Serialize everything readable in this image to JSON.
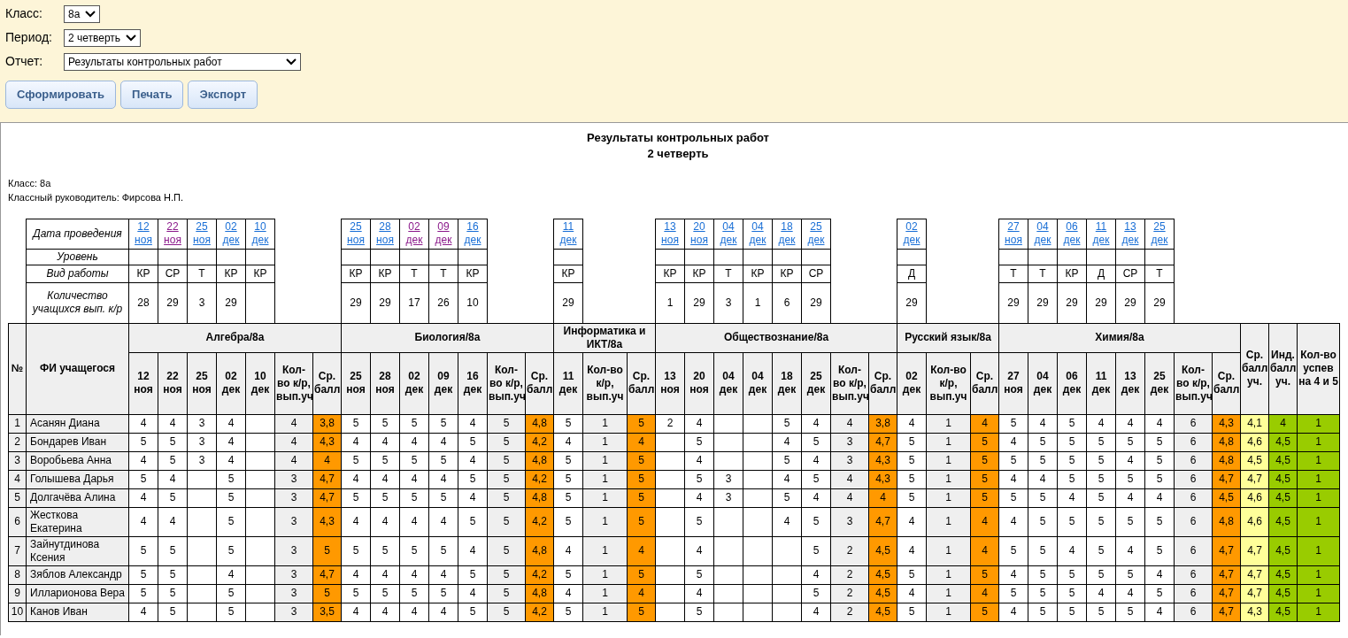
{
  "filters": [
    {
      "label": "Класс:",
      "value": "8а"
    },
    {
      "label": "Период:",
      "value": "2 четверть"
    },
    {
      "label": "Отчет:",
      "value": "Результаты контрольных работ"
    }
  ],
  "buttons": [
    "Сформировать",
    "Печать",
    "Экспорт"
  ],
  "report": {
    "title": "Результаты контрольных работ",
    "subtitle": "2 четверть",
    "info": [
      "Класс: 8а",
      "Классный руководитель: Фирсова Н.П."
    ],
    "work_labels": [
      "Дата проведения",
      "Уровень",
      "Вид работы",
      "Количество учащихся вып. к/р"
    ],
    "number_header": "№",
    "name_header": "ФИ учащегося",
    "final_headers": [
      "Ср. балл уч.",
      "Инд. балл уч.",
      "Кол-во успев на 4 и 5"
    ],
    "subjects": [
      {
        "name": "Алгебра/8а",
        "count_label": "Кол-во к/р, вып.уч",
        "avg_label": "Ср. балл",
        "works": [
          {
            "date": "12 ноя",
            "visited": false,
            "kind": "КР",
            "students": "28",
            "column": "12 ноя"
          },
          {
            "date": "22 ноя",
            "visited": true,
            "kind": "СР",
            "students": "29",
            "column": "22 ноя"
          },
          {
            "date": "25 ноя",
            "visited": false,
            "kind": "Т",
            "students": "3",
            "column": "25 ноя"
          },
          {
            "date": "02 дек",
            "visited": false,
            "kind": "КР",
            "students": "29",
            "column": "02 дек"
          },
          {
            "date": "10 дек",
            "visited": false,
            "kind": "КР",
            "column": "10 дек"
          }
        ]
      },
      {
        "name": "Биология/8а",
        "count_label": "Кол-во к/р, вып.уч",
        "avg_label": "Ср. балл",
        "works": [
          {
            "date": "25 ноя",
            "visited": false,
            "kind": "КР",
            "students": "29",
            "column": "25 ноя"
          },
          {
            "date": "28 ноя",
            "visited": false,
            "kind": "КР",
            "students": "29",
            "column": "28 ноя"
          },
          {
            "date": "02 дек",
            "visited": true,
            "kind": "Т",
            "students": "17",
            "column": "02 дек"
          },
          {
            "date": "09 дек",
            "visited": true,
            "kind": "Т",
            "students": "26",
            "column": "09 дек"
          },
          {
            "date": "16 дек",
            "visited": false,
            "kind": "КР",
            "students": "10",
            "column": "16 дек"
          }
        ]
      },
      {
        "name": "Информатика и ИКТ/8а",
        "count_label": "Кол-во к/р, вып.уч",
        "avg_label": "Ср. балл",
        "works": [
          {
            "date": "11 дек",
            "visited": false,
            "kind": "КР",
            "students": "29",
            "column": "11 дек"
          }
        ]
      },
      {
        "name": "Обществознание/8а",
        "count_label": "Кол-во к/р, вып.уч",
        "avg_label": "Ср. балл",
        "works": [
          {
            "date": "13 ноя",
            "visited": false,
            "kind": "КР",
            "students": "1",
            "column": "13 ноя"
          },
          {
            "date": "20 ноя",
            "visited": false,
            "kind": "КР",
            "students": "29",
            "column": "20 ноя"
          },
          {
            "date": "04 дек",
            "visited": false,
            "kind": "Т",
            "students": "3",
            "column": "04 дек"
          },
          {
            "date": "04 дек",
            "visited": false,
            "kind": "КР",
            "students": "1",
            "column": "04 дек"
          },
          {
            "date": "18 дек",
            "visited": false,
            "kind": "КР",
            "students": "6",
            "column": "18 дек"
          },
          {
            "date": "25 дек",
            "visited": false,
            "kind": "СР",
            "students": "29",
            "column": "25 дек"
          }
        ]
      },
      {
        "name": "Русский язык/8а",
        "count_label": "Кол-во к/р, вып.уч",
        "avg_label": "Ср. балл",
        "works": [
          {
            "date": "02 дек",
            "visited": false,
            "kind": "Д",
            "students": "29",
            "column": "02 дек"
          }
        ]
      },
      {
        "name": "Химия/8а",
        "count_label": "Кол-во к/р, вып.уч",
        "avg_label": "Ср. балл",
        "works": [
          {
            "date": "27 ноя",
            "visited": false,
            "kind": "Т",
            "students": "29",
            "column": "27 ноя"
          },
          {
            "date": "04 дек",
            "visited": false,
            "kind": "Т",
            "students": "29",
            "column": "04 дек"
          },
          {
            "date": "06 дек",
            "visited": false,
            "kind": "КР",
            "students": "29",
            "column": "06 дек"
          },
          {
            "date": "11 дек",
            "visited": false,
            "kind": "Д",
            "students": "29",
            "column": "11 дек"
          },
          {
            "date": "13 дек",
            "visited": false,
            "kind": "СР",
            "students": "29",
            "column": "13 дек"
          },
          {
            "date": "25 дек",
            "visited": false,
            "kind": "Т",
            "students": "29",
            "column": "25 дек"
          }
        ]
      }
    ],
    "rows": [
      {
        "num": "1",
        "name": "Асанян Диана",
        "subjects": [
          {
            "marks": [
              {
                "mark": "4"
              },
              {
                "mark": "4"
              },
              {
                "mark": "3"
              },
              {
                "mark": "4"
              },
              {
                "blank": true
              }
            ],
            "count": "4",
            "avg": "3,8"
          },
          {
            "marks": [
              {
                "mark": "5"
              },
              {
                "mark": "5"
              },
              {
                "mark": "5"
              },
              {
                "mark": "5"
              },
              {
                "mark": "4"
              }
            ],
            "count": "5",
            "avg": "4,8"
          },
          {
            "marks": [
              {
                "mark": "5"
              }
            ],
            "count": "1",
            "avg": "5"
          },
          {
            "marks": [
              {
                "mark": "2"
              },
              {
                "mark": "4"
              },
              {
                "blank": true
              },
              {
                "blank": true
              },
              {
                "mark": "5"
              },
              {
                "mark": "4"
              }
            ],
            "count": "4",
            "avg": "3,8"
          },
          {
            "marks": [
              {
                "mark": "4"
              }
            ],
            "count": "1",
            "avg": "4"
          },
          {
            "marks": [
              {
                "mark": "5"
              },
              {
                "mark": "4"
              },
              {
                "mark": "5"
              },
              {
                "mark": "4"
              },
              {
                "mark": "4"
              },
              {
                "mark": "4"
              }
            ],
            "count": "6",
            "avg": "4,3"
          }
        ],
        "total_avg": "4,1",
        "ind_avg": "4",
        "success": "1"
      },
      {
        "num": "2",
        "name": "Бондарев Иван",
        "subjects": [
          {
            "marks": [
              {
                "mark": "5"
              },
              {
                "mark": "5"
              },
              {
                "mark": "3"
              },
              {
                "mark": "4"
              },
              {
                "blank": true
              }
            ],
            "count": "4",
            "avg": "4,3"
          },
          {
            "marks": [
              {
                "mark": "4"
              },
              {
                "mark": "4"
              },
              {
                "mark": "4"
              },
              {
                "mark": "4"
              },
              {
                "mark": "5"
              }
            ],
            "count": "5",
            "avg": "4,2"
          },
          {
            "marks": [
              {
                "mark": "4"
              }
            ],
            "count": "1",
            "avg": "4"
          },
          {
            "marks": [
              {
                "blank": true
              },
              {
                "mark": "5"
              },
              {
                "blank": true
              },
              {
                "blank": true
              },
              {
                "mark": "4"
              },
              {
                "mark": "5"
              }
            ],
            "count": "3",
            "avg": "4,7"
          },
          {
            "marks": [
              {
                "mark": "5"
              }
            ],
            "count": "1",
            "avg": "5"
          },
          {
            "marks": [
              {
                "mark": "4"
              },
              {
                "mark": "5"
              },
              {
                "mark": "5"
              },
              {
                "mark": "5"
              },
              {
                "mark": "5"
              },
              {
                "mark": "5"
              }
            ],
            "count": "6",
            "avg": "4,8"
          }
        ],
        "total_avg": "4,6",
        "ind_avg": "4,5",
        "success": "1"
      },
      {
        "num": "3",
        "name": "Воробьева Анна",
        "subjects": [
          {
            "marks": [
              {
                "mark": "4"
              },
              {
                "mark": "5"
              },
              {
                "mark": "3"
              },
              {
                "mark": "4"
              },
              {
                "blank": true
              }
            ],
            "count": "4",
            "avg": "4"
          },
          {
            "marks": [
              {
                "mark": "5"
              },
              {
                "mark": "5"
              },
              {
                "mark": "5"
              },
              {
                "mark": "5"
              },
              {
                "mark": "4"
              }
            ],
            "count": "5",
            "avg": "4,8"
          },
          {
            "marks": [
              {
                "mark": "5"
              }
            ],
            "count": "1",
            "avg": "5"
          },
          {
            "marks": [
              {
                "blank": true
              },
              {
                "mark": "4"
              },
              {
                "blank": true
              },
              {
                "blank": true
              },
              {
                "mark": "5"
              },
              {
                "mark": "4"
              }
            ],
            "count": "3",
            "avg": "4,3"
          },
          {
            "marks": [
              {
                "mark": "5"
              }
            ],
            "count": "1",
            "avg": "5"
          },
          {
            "marks": [
              {
                "mark": "5"
              },
              {
                "mark": "5"
              },
              {
                "mark": "5"
              },
              {
                "mark": "5"
              },
              {
                "mark": "4"
              },
              {
                "mark": "5"
              }
            ],
            "count": "6",
            "avg": "4,8"
          }
        ],
        "total_avg": "4,5",
        "ind_avg": "4,5",
        "success": "1"
      },
      {
        "num": "4",
        "name": "Голышева Дарья",
        "subjects": [
          {
            "marks": [
              {
                "mark": "5"
              },
              {
                "mark": "4"
              },
              {
                "blank": true
              },
              {
                "mark": "5"
              },
              {
                "blank": true
              }
            ],
            "count": "3",
            "avg": "4,7"
          },
          {
            "marks": [
              {
                "mark": "4"
              },
              {
                "mark": "4"
              },
              {
                "mark": "4"
              },
              {
                "mark": "4"
              },
              {
                "mark": "5"
              }
            ],
            "count": "5",
            "avg": "4,2"
          },
          {
            "marks": [
              {
                "mark": "5"
              }
            ],
            "count": "1",
            "avg": "5"
          },
          {
            "marks": [
              {
                "blank": true
              },
              {
                "mark": "5"
              },
              {
                "mark": "3"
              },
              {
                "blank": true
              },
              {
                "mark": "4"
              },
              {
                "mark": "5"
              }
            ],
            "count": "4",
            "avg": "4,3"
          },
          {
            "marks": [
              {
                "mark": "5"
              }
            ],
            "count": "1",
            "avg": "5"
          },
          {
            "marks": [
              {
                "mark": "4"
              },
              {
                "mark": "4"
              },
              {
                "mark": "5"
              },
              {
                "mark": "5"
              },
              {
                "mark": "5"
              },
              {
                "mark": "5"
              }
            ],
            "count": "6",
            "avg": "4,7"
          }
        ],
        "total_avg": "4,7",
        "ind_avg": "4,5",
        "success": "1"
      },
      {
        "num": "5",
        "name": "Долгачёва Алина",
        "subjects": [
          {
            "marks": [
              {
                "mark": "4"
              },
              {
                "mark": "5"
              },
              {
                "blank": true
              },
              {
                "mark": "5"
              },
              {
                "blank": true
              }
            ],
            "count": "3",
            "avg": "4,7"
          },
          {
            "marks": [
              {
                "mark": "5"
              },
              {
                "mark": "5"
              },
              {
                "mark": "5"
              },
              {
                "mark": "5"
              },
              {
                "mark": "4"
              }
            ],
            "count": "5",
            "avg": "4,8"
          },
          {
            "marks": [
              {
                "mark": "5"
              }
            ],
            "count": "1",
            "avg": "5"
          },
          {
            "marks": [
              {
                "blank": true
              },
              {
                "mark": "4"
              },
              {
                "mark": "3"
              },
              {
                "blank": true
              },
              {
                "mark": "5"
              },
              {
                "mark": "4"
              }
            ],
            "count": "4",
            "avg": "4"
          },
          {
            "marks": [
              {
                "mark": "5"
              }
            ],
            "count": "1",
            "avg": "5"
          },
          {
            "marks": [
              {
                "mark": "5"
              },
              {
                "mark": "5"
              },
              {
                "mark": "4"
              },
              {
                "mark": "5"
              },
              {
                "mark": "4"
              },
              {
                "mark": "4"
              }
            ],
            "count": "6",
            "avg": "4,5"
          }
        ],
        "total_avg": "4,6",
        "ind_avg": "4,5",
        "success": "1"
      },
      {
        "num": "6",
        "name": "Жесткова Екатерина",
        "subjects": [
          {
            "marks": [
              {
                "mark": "4"
              },
              {
                "mark": "4"
              },
              {
                "blank": true
              },
              {
                "mark": "5"
              },
              {
                "blank": true
              }
            ],
            "count": "3",
            "avg": "4,3"
          },
          {
            "marks": [
              {
                "mark": "4"
              },
              {
                "mark": "4"
              },
              {
                "mark": "4"
              },
              {
                "mark": "4"
              },
              {
                "mark": "5"
              }
            ],
            "count": "5",
            "avg": "4,2"
          },
          {
            "marks": [
              {
                "mark": "5"
              }
            ],
            "count": "1",
            "avg": "5"
          },
          {
            "marks": [
              {
                "blank": true
              },
              {
                "mark": "5"
              },
              {
                "blank": true
              },
              {
                "blank": true
              },
              {
                "mark": "4"
              },
              {
                "mark": "5"
              }
            ],
            "count": "3",
            "avg": "4,7"
          },
          {
            "marks": [
              {
                "mark": "4"
              }
            ],
            "count": "1",
            "avg": "4"
          },
          {
            "marks": [
              {
                "mark": "4"
              },
              {
                "mark": "5"
              },
              {
                "mark": "5"
              },
              {
                "mark": "5"
              },
              {
                "mark": "5"
              },
              {
                "mark": "5"
              }
            ],
            "count": "6",
            "avg": "4,8"
          }
        ],
        "total_avg": "4,6",
        "ind_avg": "4,5",
        "success": "1"
      },
      {
        "num": "7",
        "name": "Зайнутдинова Ксения",
        "subjects": [
          {
            "marks": [
              {
                "mark": "5"
              },
              {
                "mark": "5"
              },
              {
                "blank": true
              },
              {
                "mark": "5"
              },
              {
                "blank": true
              }
            ],
            "count": "3",
            "avg": "5"
          },
          {
            "marks": [
              {
                "mark": "5"
              },
              {
                "mark": "5"
              },
              {
                "mark": "5"
              },
              {
                "mark": "5"
              },
              {
                "mark": "4"
              }
            ],
            "count": "5",
            "avg": "4,8"
          },
          {
            "marks": [
              {
                "mark": "4"
              }
            ],
            "count": "1",
            "avg": "4"
          },
          {
            "marks": [
              {
                "blank": true
              },
              {
                "mark": "4"
              },
              {
                "blank": true
              },
              {
                "blank": true
              },
              {
                "blank": true
              },
              {
                "mark": "5"
              }
            ],
            "count": "2",
            "avg": "4,5"
          },
          {
            "marks": [
              {
                "mark": "4"
              }
            ],
            "count": "1",
            "avg": "4"
          },
          {
            "marks": [
              {
                "mark": "5"
              },
              {
                "mark": "5"
              },
              {
                "mark": "4"
              },
              {
                "mark": "5"
              },
              {
                "mark": "4"
              },
              {
                "mark": "5"
              }
            ],
            "count": "6",
            "avg": "4,7"
          }
        ],
        "total_avg": "4,7",
        "ind_avg": "4,5",
        "success": "1"
      },
      {
        "num": "8",
        "name": "Зяблов Александр",
        "subjects": [
          {
            "marks": [
              {
                "mark": "5"
              },
              {
                "mark": "5"
              },
              {
                "blank": true
              },
              {
                "mark": "4"
              },
              {
                "blank": true
              }
            ],
            "count": "3",
            "avg": "4,7"
          },
          {
            "marks": [
              {
                "mark": "4"
              },
              {
                "mark": "4"
              },
              {
                "mark": "4"
              },
              {
                "mark": "4"
              },
              {
                "mark": "5"
              }
            ],
            "count": "5",
            "avg": "4,2"
          },
          {
            "marks": [
              {
                "mark": "5"
              }
            ],
            "count": "1",
            "avg": "5"
          },
          {
            "marks": [
              {
                "blank": true
              },
              {
                "mark": "5"
              },
              {
                "blank": true
              },
              {
                "blank": true
              },
              {
                "blank": true
              },
              {
                "mark": "4"
              }
            ],
            "count": "2",
            "avg": "4,5"
          },
          {
            "marks": [
              {
                "mark": "5"
              }
            ],
            "count": "1",
            "avg": "5"
          },
          {
            "marks": [
              {
                "mark": "4"
              },
              {
                "mark": "5"
              },
              {
                "mark": "5"
              },
              {
                "mark": "5"
              },
              {
                "mark": "5"
              },
              {
                "mark": "4"
              }
            ],
            "count": "6",
            "avg": "4,7"
          }
        ],
        "total_avg": "4,7",
        "ind_avg": "4,5",
        "success": "1"
      },
      {
        "num": "9",
        "name": "Илларионова Вера",
        "subjects": [
          {
            "marks": [
              {
                "mark": "5"
              },
              {
                "mark": "5"
              },
              {
                "blank": true
              },
              {
                "mark": "5"
              },
              {
                "blank": true
              }
            ],
            "count": "3",
            "avg": "5"
          },
          {
            "marks": [
              {
                "mark": "5"
              },
              {
                "mark": "5"
              },
              {
                "mark": "5"
              },
              {
                "mark": "5"
              },
              {
                "mark": "4"
              }
            ],
            "count": "5",
            "avg": "4,8"
          },
          {
            "marks": [
              {
                "mark": "4"
              }
            ],
            "count": "1",
            "avg": "4"
          },
          {
            "marks": [
              {
                "blank": true
              },
              {
                "mark": "4"
              },
              {
                "blank": true
              },
              {
                "blank": true
              },
              {
                "blank": true
              },
              {
                "mark": "5"
              }
            ],
            "count": "2",
            "avg": "4,5"
          },
          {
            "marks": [
              {
                "mark": "4"
              }
            ],
            "count": "1",
            "avg": "4"
          },
          {
            "marks": [
              {
                "mark": "5"
              },
              {
                "mark": "5"
              },
              {
                "mark": "5"
              },
              {
                "mark": "4"
              },
              {
                "mark": "4"
              },
              {
                "mark": "5"
              }
            ],
            "count": "6",
            "avg": "4,7"
          }
        ],
        "total_avg": "4,7",
        "ind_avg": "4,5",
        "success": "1"
      },
      {
        "num": "10",
        "name": "Канов Иван",
        "subjects": [
          {
            "marks": [
              {
                "mark": "4"
              },
              {
                "mark": "5"
              },
              {
                "blank": true
              },
              {
                "mark": "5"
              },
              {
                "blank": true
              }
            ],
            "count": "3",
            "avg": "3,5"
          },
          {
            "marks": [
              {
                "mark": "4"
              },
              {
                "mark": "4"
              },
              {
                "mark": "4"
              },
              {
                "mark": "4"
              },
              {
                "mark": "5"
              }
            ],
            "count": "5",
            "avg": "4,2"
          },
          {
            "marks": [
              {
                "mark": "5"
              }
            ],
            "count": "1",
            "avg": "5"
          },
          {
            "marks": [
              {
                "blank": true
              },
              {
                "mark": "5"
              },
              {
                "blank": true
              },
              {
                "blank": true
              },
              {
                "blank": true
              },
              {
                "mark": "4"
              }
            ],
            "count": "2",
            "avg": "4,5"
          },
          {
            "marks": [
              {
                "mark": "5"
              }
            ],
            "count": "1",
            "avg": "5"
          },
          {
            "marks": [
              {
                "mark": "4"
              },
              {
                "mark": "5"
              },
              {
                "mark": "5"
              },
              {
                "mark": "5"
              },
              {
                "mark": "5"
              },
              {
                "mark": "4"
              }
            ],
            "count": "6",
            "avg": "4,7"
          }
        ],
        "total_avg": "4,3",
        "ind_avg": "4,5",
        "success": "1"
      }
    ]
  }
}
